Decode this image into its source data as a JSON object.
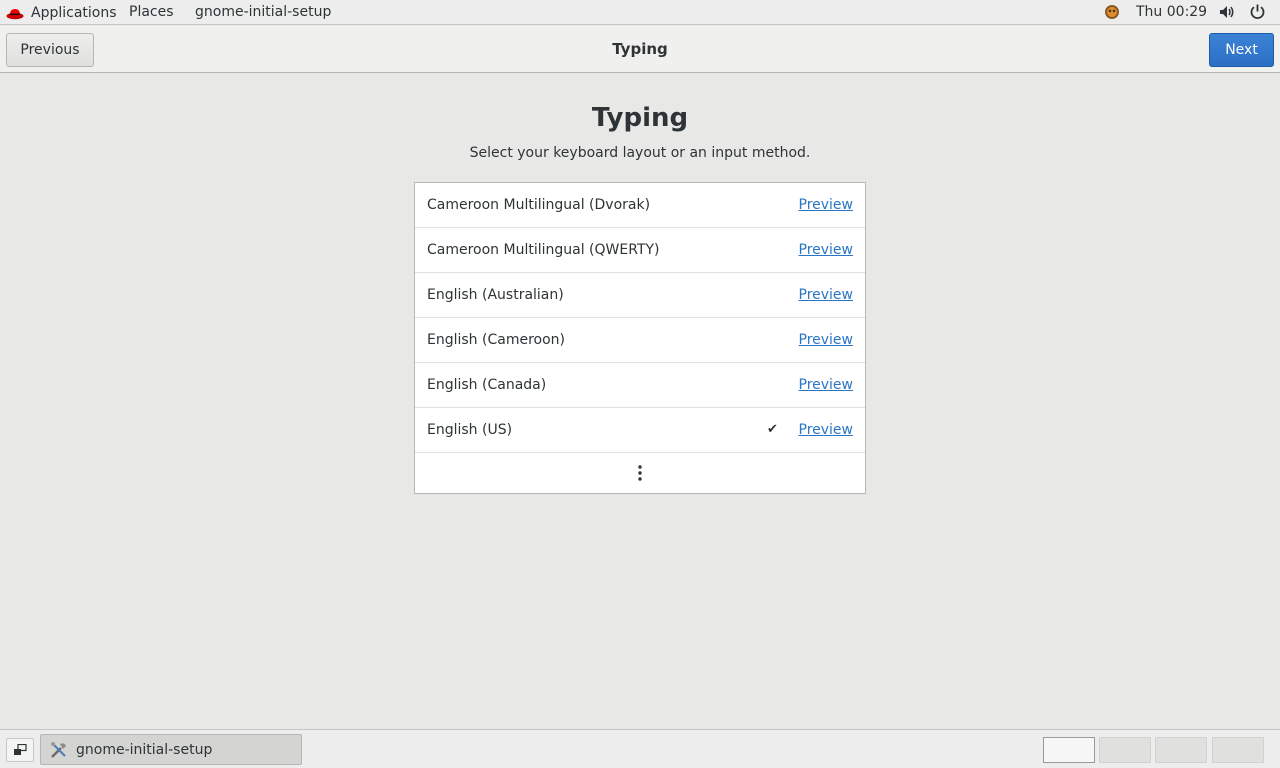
{
  "topbar": {
    "applications_label": "Applications",
    "places_label": "Places",
    "app_name": "gnome-initial-setup",
    "clock": "Thu 00:29"
  },
  "header": {
    "previous_label": "Previous",
    "title": "Typing",
    "next_label": "Next"
  },
  "main": {
    "title": "Typing",
    "subtitle": "Select your keyboard layout or an input method.",
    "layouts": [
      {
        "label": "Cameroon Multilingual (Dvorak)",
        "preview": "Preview",
        "selected": false
      },
      {
        "label": "Cameroon Multilingual (QWERTY)",
        "preview": "Preview",
        "selected": false
      },
      {
        "label": "English (Australian)",
        "preview": "Preview",
        "selected": false
      },
      {
        "label": "English (Cameroon)",
        "preview": "Preview",
        "selected": false
      },
      {
        "label": "English (Canada)",
        "preview": "Preview",
        "selected": false
      },
      {
        "label": "English (US)",
        "preview": "Preview",
        "selected": true,
        "check": "✔"
      }
    ]
  },
  "taskbar": {
    "window_label": "gnome-initial-setup",
    "workspaces": 4,
    "active_workspace": 1
  },
  "colors": {
    "accent": "#2b6fc3",
    "link": "#2a76c6",
    "background": "#e8e8e7"
  }
}
